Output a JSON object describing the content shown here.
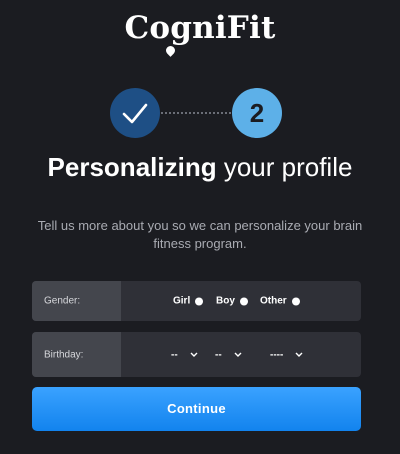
{
  "brand": {
    "logo_text": "CogniFit"
  },
  "steps": {
    "step1_state": "completed",
    "step2_number": "2"
  },
  "heading": {
    "strong": "Personalizing",
    "light": " your profile"
  },
  "subtitle": "Tell us more about you so we can personalize your brain fitness program.",
  "form": {
    "gender": {
      "label": "Gender:",
      "options": [
        "Girl",
        "Boy",
        "Other"
      ]
    },
    "birthday": {
      "label": "Birthday:",
      "day": "--",
      "month": "--",
      "year": "----"
    }
  },
  "continue_label": "Continue",
  "colors": {
    "background": "#1b1c21",
    "step_done": "#1e4f85",
    "step_active": "#5db0e8",
    "button": "#2196f3"
  }
}
